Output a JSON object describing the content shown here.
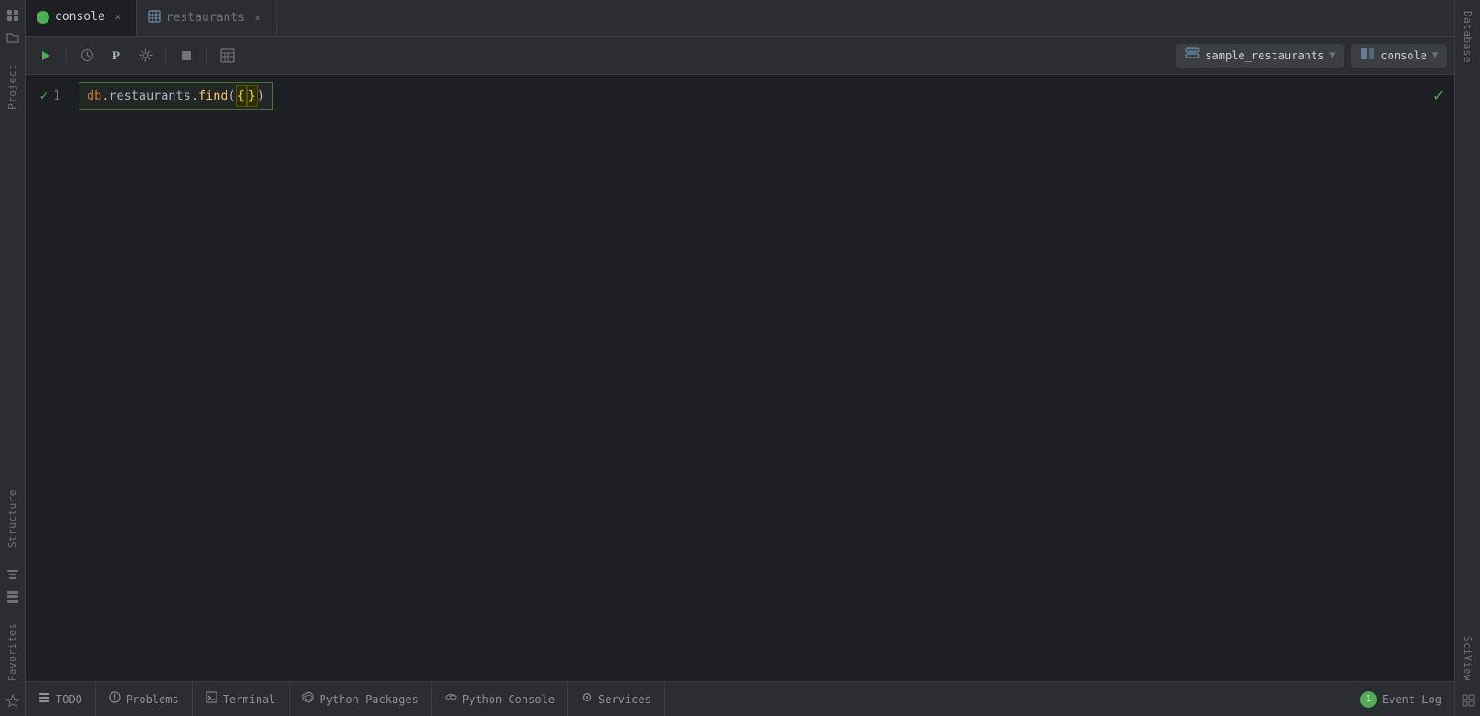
{
  "tabs": [
    {
      "id": "console",
      "label": "console",
      "icon": "console-icon",
      "active": true
    },
    {
      "id": "restaurants",
      "label": "restaurants",
      "icon": "table-icon",
      "active": false
    }
  ],
  "toolbar": {
    "run_label": "▶",
    "history_label": "⏱",
    "python_label": "P",
    "settings_label": "🔧",
    "stop_label": "■",
    "table_label": "≡",
    "db_selector": "sample_restaurants",
    "console_selector": "console"
  },
  "editor": {
    "line_number": "1",
    "code": "db.restaurants.find({})",
    "code_parts": {
      "db": "db",
      "dot1": ".",
      "collection": "restaurants",
      "dot2": ".",
      "method": "find",
      "paren_open": "(",
      "brace_open": "{",
      "brace_close": "}",
      "paren_close": ")"
    }
  },
  "left_sidebar": {
    "items": [
      {
        "id": "project",
        "label": "Project"
      },
      {
        "id": "structure",
        "label": "Structure"
      },
      {
        "id": "favorites",
        "label": "Favorites"
      }
    ]
  },
  "right_sidebar": {
    "items": [
      {
        "id": "database",
        "label": "Database"
      },
      {
        "id": "sciview",
        "label": "SciView"
      }
    ]
  },
  "status_bar": {
    "items": [
      {
        "id": "todo",
        "icon": "≡",
        "label": "TODO"
      },
      {
        "id": "problems",
        "icon": "⊘",
        "label": "Problems"
      },
      {
        "id": "terminal",
        "icon": "▶",
        "label": "Terminal"
      },
      {
        "id": "python-packages",
        "icon": "⬡",
        "label": "Python Packages"
      },
      {
        "id": "python-console",
        "icon": "🐍",
        "label": "Python Console"
      },
      {
        "id": "services",
        "icon": "◉",
        "label": "Services"
      }
    ],
    "event_log": {
      "badge": "1",
      "label": "Event Log"
    }
  }
}
